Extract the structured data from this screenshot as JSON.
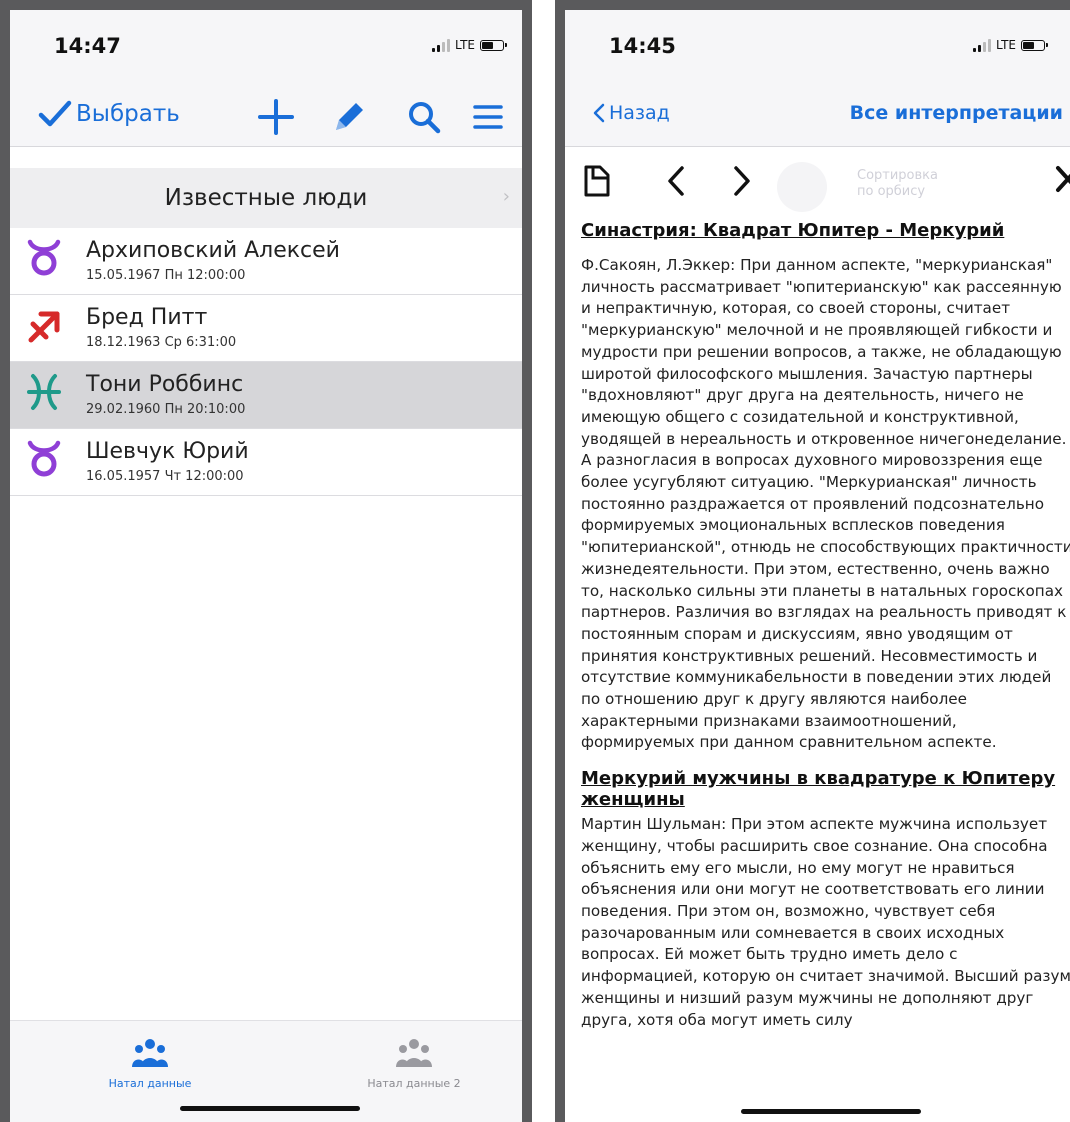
{
  "left_screen": {
    "status": {
      "time": "14:47",
      "network": "LTE"
    },
    "nav": {
      "select_label": "Выбрать"
    },
    "section": {
      "title": "Известные люди"
    },
    "people": [
      {
        "name": "Архиповский Алексей",
        "date": "15.05.1967 Пн 12:00:00",
        "sign": "taurus-icon",
        "color": "#8f3fd6"
      },
      {
        "name": "Бред Питт",
        "date": "18.12.1963 Ср 6:31:00",
        "sign": "sagittarius-icon",
        "color": "#d62a2a"
      },
      {
        "name": "Тони Роббинс",
        "date": "29.02.1960 Пн 20:10:00",
        "sign": "pisces-icon",
        "color": "#1f9a8a"
      },
      {
        "name": "Шевчук Юрий",
        "date": "16.05.1957 Чт 12:00:00",
        "sign": "taurus-icon",
        "color": "#8f3fd6"
      }
    ],
    "tabs": [
      {
        "label": "Натал данные",
        "active": true
      },
      {
        "label": "Натал данные 2",
        "active": false
      }
    ]
  },
  "right_screen": {
    "status": {
      "time": "14:45",
      "network": "LTE"
    },
    "nav": {
      "back_label": "Назад",
      "all_label": "Все интерпретации"
    },
    "toolbar": {
      "sort_label_line1": "Сортировка",
      "sort_label_line2": "по орбису"
    },
    "interpretations": [
      {
        "title": "Синастрия: Квадрат Юпитер - Меркурий",
        "body": "Ф.Сакоян, Л.Эккер: При данном аспекте, \"меркурианская\" личность рассматривает \"юпитерианскую\" как рассеянную и непрактичную, которая, со своей стороны, считает \"меркурианскую\" мелочной и не проявляющей гибкости и мудрости при решении вопросов, а также, не обладающую широтой философского мышления. Зачастую партнеры \"вдохновляют\" друг друга на деятельность, ничего не имеющую общего с созидательной и конструктивной, уводящей в нереальность и откровенное ничегонеделание. А разногласия в вопросах духовного мировоззрения еще более усугубляют ситуацию. \"Меркурианская\" личность постоянно раздражается от проявлений подсознательно формируемых эмоциональных всплесков поведения \"юпитерианской\", отнюдь не способствующих практичности жизнедеятельности. При этом, естественно, очень важно то, насколько сильны эти планеты в натальных гороскопах партнеров. Различия во взглядах на реальность приводят к постоянным спорам и дискуссиям, явно уводящим от принятия конструктивных решений. Несовместимость и отсутствие коммуникабельности в поведении этих людей по отношению друг к другу являются наиболее характерными признаками взаимоотношений, формируемых при данном сравнительном аспекте."
      },
      {
        "title": "Меркурий мужчины в квадратуре к Юпитеру женщины",
        "body": "Мартин Шульман: При этом аспекте мужчина использует женщину, чтобы расширить свое сознание. Она способна объяснить ему его мысли, но ему могут не нравиться объяснения или они могут не соответствовать его линии поведения. При этом он, возможно, чувствует себя разочарованным или сомневается в своих исходных вопросах. Ей может быть трудно иметь дело с информацией, которую он считает значимой. Высший разум женщины и низший разум мужчины не дополняют друг друга, хотя оба могут иметь силу"
      }
    ]
  },
  "colors": {
    "accent": "#1a6ed8",
    "selected_row": "#d6d6d9"
  }
}
